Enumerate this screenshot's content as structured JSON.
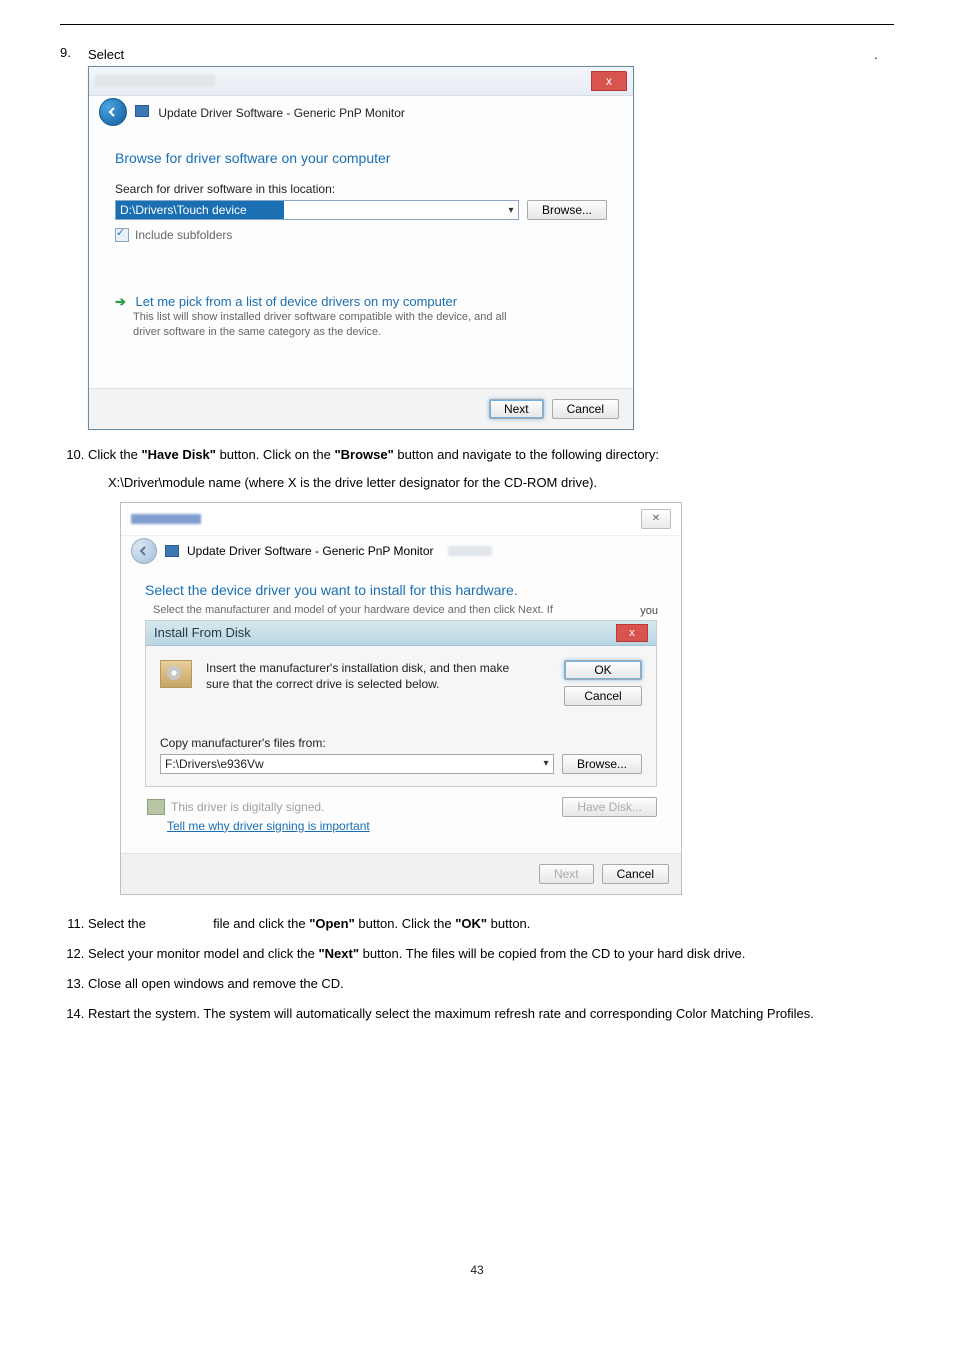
{
  "step9": {
    "number": "9.",
    "label": "Select",
    "trail_dot": "."
  },
  "win1": {
    "breadcrumb": "Update Driver Software - Generic PnP Monitor",
    "heading": "Browse for driver software on your computer",
    "search_label": "Search for driver software in this location:",
    "path_value": "D:\\Drivers\\Touch device",
    "browse": "Browse...",
    "include_sub": "Include subfolders",
    "opt_title": "Let me pick from a list of device drivers on my computer",
    "opt_sub1": "This list will show installed driver software compatible with the device, and all",
    "opt_sub2": "driver software in the same category as the device.",
    "next": "Next",
    "cancel": "Cancel",
    "close_x": "x"
  },
  "step10": {
    "line1_a": "Click the ",
    "line1_b": "\"Have Disk\"",
    "line1_c": " button. Click on the ",
    "line1_d": "\"Browse\"",
    "line1_e": " button and navigate to the following directory:",
    "line2": "X:\\Driver\\module name (where X is the drive letter designator for the CD-ROM drive)."
  },
  "win2": {
    "breadcrumb": "Update Driver Software - Generic PnP Monitor",
    "heading": "Select the device driver you want to install for this hardware.",
    "hint_line": "Select the manufacturer and model of your hardware device and then click Next. If",
    "hint_trail": "you",
    "ifd_title": "Install From Disk",
    "insert1": "Insert the manufacturer's installation disk, and then make",
    "insert2": "sure that the correct drive is selected below.",
    "ok": "OK",
    "cancel": "Cancel",
    "copy_label": "Copy manufacturer's files from:",
    "copy_value": "F:\\Drivers\\e936Vw",
    "browse": "Browse...",
    "sig": "This driver is digitally signed.",
    "tell": "Tell me why driver signing is important",
    "have_disk": "Have Disk...",
    "next": "Next",
    "foot_cancel": "Cancel",
    "close_x": "x"
  },
  "step11": {
    "a": "Select the",
    "b": "file and click the ",
    "c": "\"Open\"",
    "d": " button. Click the ",
    "e": "\"OK\"",
    "f": " button."
  },
  "step12": {
    "a": "Select your monitor model and click the ",
    "b": "\"Next\"",
    "c": " button. The files will be copied from the CD to your hard disk drive."
  },
  "step13": "Close all open windows and remove the CD.",
  "step14": "Restart the system. The system will automatically select the maximum refresh rate and corresponding Color Matching Profiles.",
  "pagenum": "43"
}
